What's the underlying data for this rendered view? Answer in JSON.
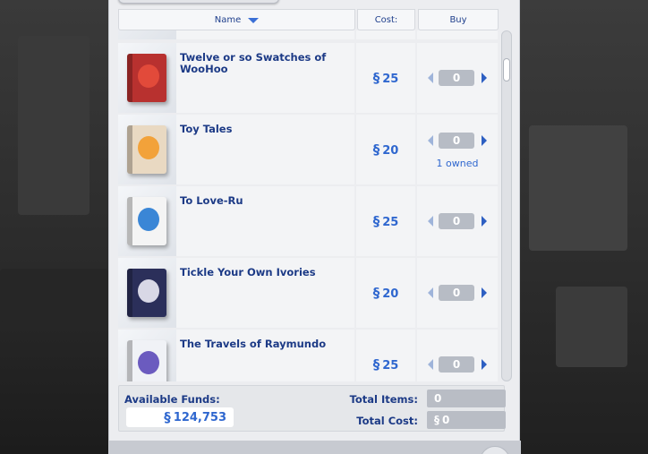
{
  "header": {
    "name_label": "Name",
    "cost_label": "Cost:",
    "buy_label": "Buy"
  },
  "currency_symbol": "§",
  "items": [
    {
      "title": "Twelve or so Swatches of WooHoo",
      "price": "25",
      "qty": "0",
      "owned": "",
      "cover_color": "#b8312f",
      "art_color": "#e24a3a"
    },
    {
      "title": "Toy Tales",
      "price": "20",
      "qty": "0",
      "owned": "1 owned",
      "cover_color": "#e9d9c2",
      "art_color": "#f2a23a"
    },
    {
      "title": "To Love-Ru",
      "price": "25",
      "qty": "0",
      "owned": "",
      "cover_color": "#f4f4f4",
      "art_color": "#3a86d6"
    },
    {
      "title": "Tickle Your Own Ivories",
      "price": "20",
      "qty": "0",
      "owned": "",
      "cover_color": "#2b2f5a",
      "art_color": "#d8d8e6"
    },
    {
      "title": "The Travels of Raymundo",
      "price": "25",
      "qty": "0",
      "owned": "",
      "cover_color": "#f0f2f6",
      "art_color": "#6b5bbf"
    }
  ],
  "footer": {
    "available_funds_label": "Available Funds:",
    "available_funds_value": "124,753",
    "total_items_label": "Total Items:",
    "total_items_value": "0",
    "total_cost_label": "Total Cost:",
    "total_cost_value": "0"
  }
}
